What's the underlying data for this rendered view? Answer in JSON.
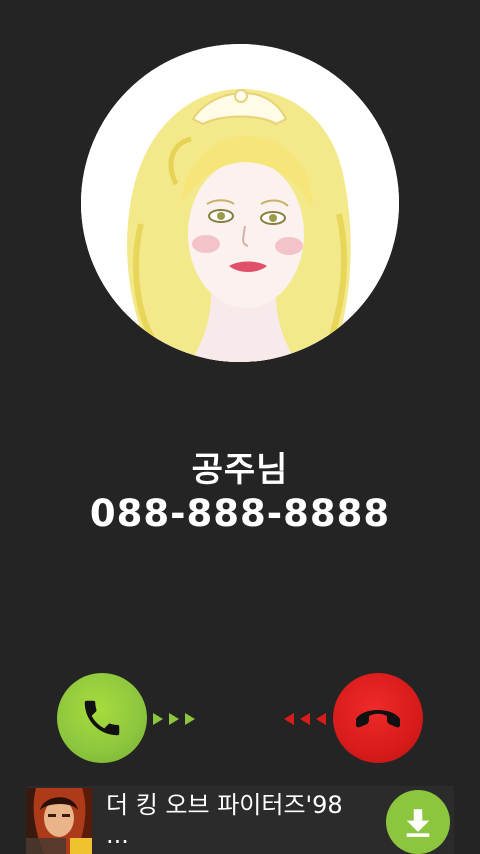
{
  "caller": {
    "name": "공주님",
    "number": "088-888-8888"
  },
  "controls": {
    "accept_icon": "phone-handset-icon",
    "decline_icon": "hang-up-icon",
    "accept_color": "#8cc63f",
    "decline_color": "#d81b1b",
    "arrow_accept_color": "#8cc63f",
    "arrow_decline_color": "#d81b1b"
  },
  "ad": {
    "title": "더 킹 오브 파이터즈'98",
    "subtitle": "...",
    "download_icon": "download-icon"
  }
}
